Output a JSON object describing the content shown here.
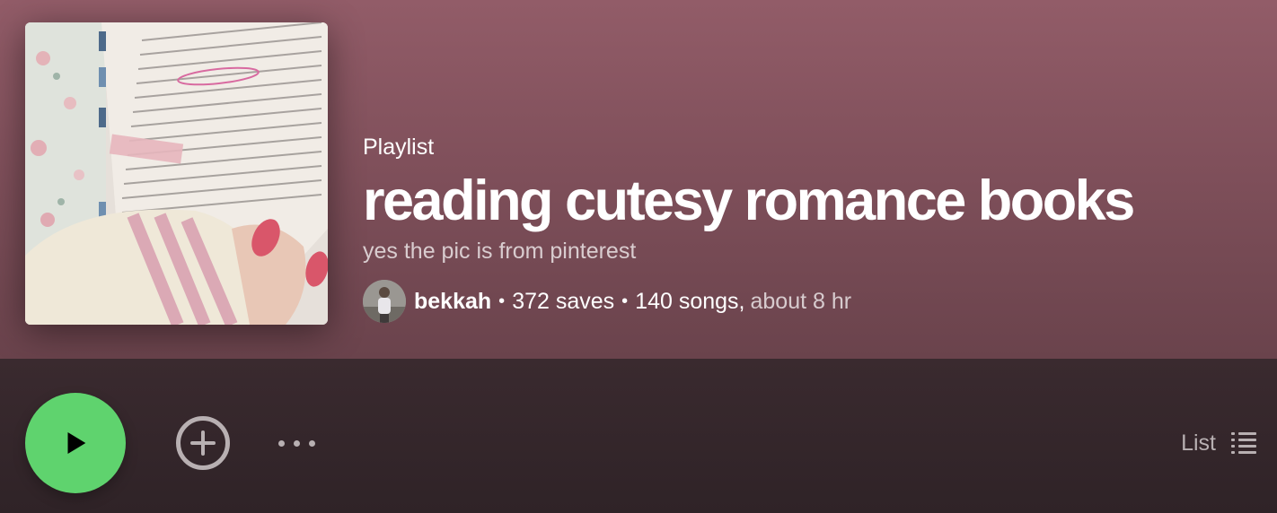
{
  "playlist": {
    "type_label": "Playlist",
    "title": "reading cutesy romance books",
    "description": "yes the pic is from pinterest",
    "owner": "bekkah",
    "saves": "372 saves",
    "songs": "140 songs,",
    "duration": "about 8 hr",
    "separator": "•"
  },
  "controls": {
    "view_mode_label": "List"
  },
  "icons": {
    "play": "play-icon",
    "add": "plus-circle-icon",
    "more": "more-options-icon",
    "list": "list-view-icon"
  },
  "colors": {
    "accent_green": "#5fd36e",
    "header_top": "#925c68",
    "controls_bg": "#2f2327"
  }
}
